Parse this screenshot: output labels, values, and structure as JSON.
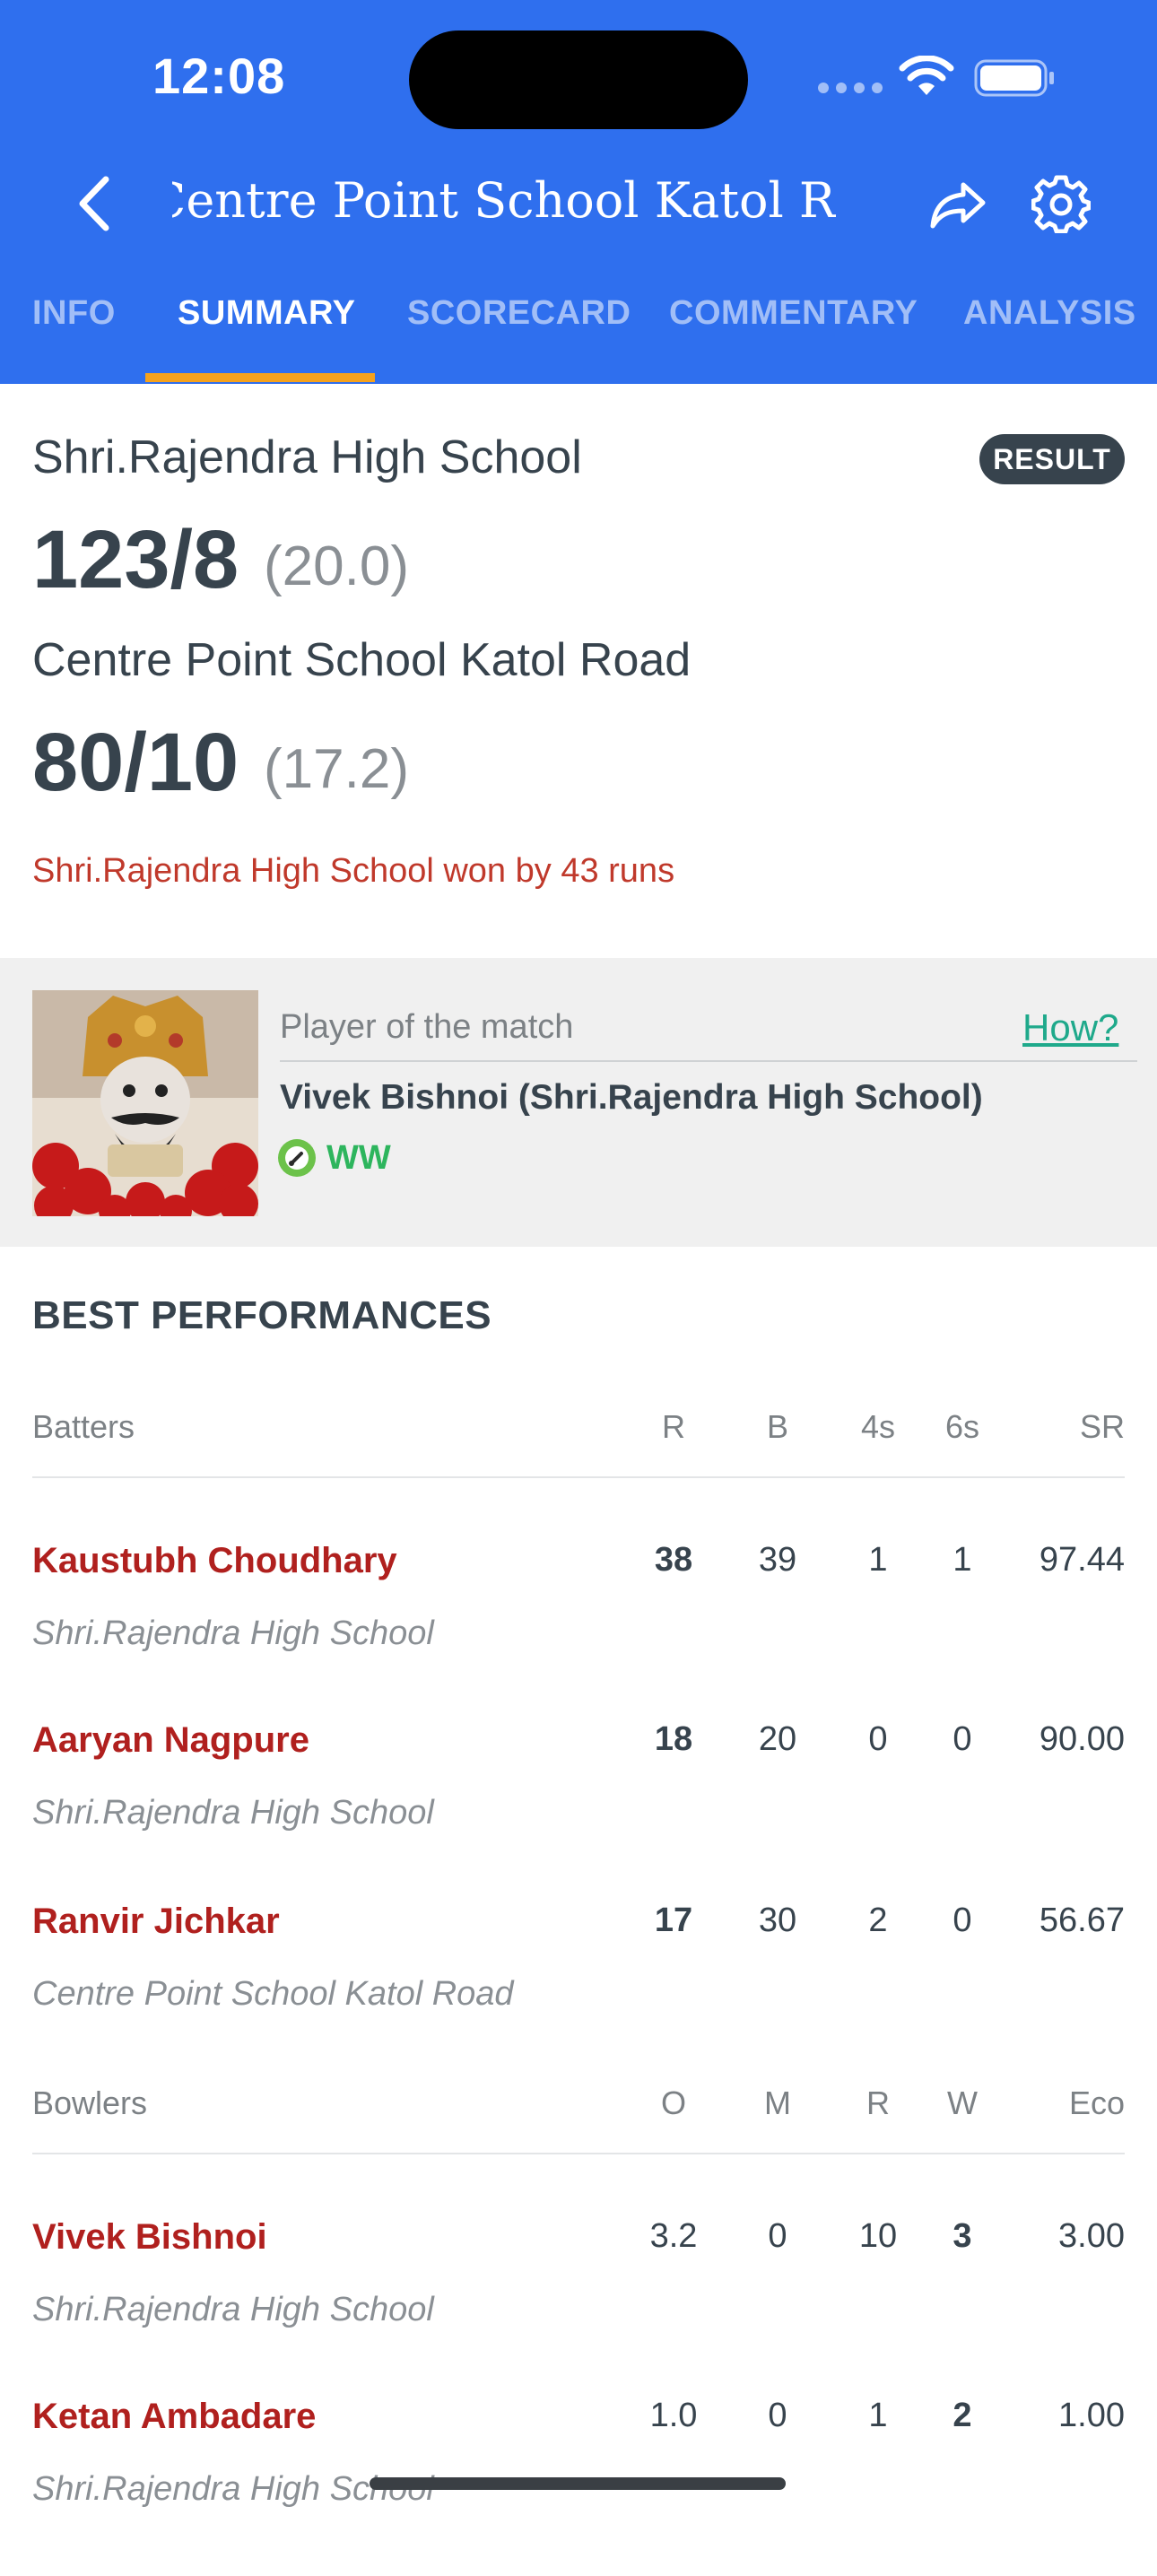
{
  "status_bar": {
    "time": "12:08"
  },
  "header": {
    "title": "Centre Point School Katol Road vs Shri.Rajendra High School",
    "tabs": [
      "INFO",
      "SUMMARY",
      "SCORECARD",
      "COMMENTARY",
      "ANALYSIS"
    ],
    "active_tab": "SUMMARY",
    "colors": {
      "bar": "#2f6fee",
      "indicator": "#f6a21d"
    }
  },
  "summary": {
    "team1": {
      "name": "Shri.Rajendra High School",
      "score": "123/8",
      "overs": "(20.0)"
    },
    "team2": {
      "name": "Centre Point School Katol Road",
      "score": "80/10",
      "overs": "(17.2)"
    },
    "badge": "RESULT",
    "result": "Shri.Rajendra High School won by 43 runs"
  },
  "player_of_match": {
    "label": "Player of the match",
    "how_link": "How?",
    "name": "Vivek Bishnoi (Shri.Rajendra High School)",
    "tag": "WW"
  },
  "best_performances": {
    "title": "BEST PERFORMANCES",
    "batters_header": [
      "Batters",
      "R",
      "B",
      "4s",
      "6s",
      "SR"
    ],
    "batters": [
      {
        "name": "Kaustubh Choudhary",
        "team": "Shri.Rajendra High School",
        "r": "38",
        "b": "39",
        "fours": "1",
        "sixes": "1",
        "sr": "97.44"
      },
      {
        "name": "Aaryan Nagpure",
        "team": "Shri.Rajendra High School",
        "r": "18",
        "b": "20",
        "fours": "0",
        "sixes": "0",
        "sr": "90.00"
      },
      {
        "name": "Ranvir Jichkar",
        "team": "Centre Point School Katol Road",
        "r": "17",
        "b": "30",
        "fours": "2",
        "sixes": "0",
        "sr": "56.67"
      }
    ],
    "bowlers_header": [
      "Bowlers",
      "O",
      "M",
      "R",
      "W",
      "Eco"
    ],
    "bowlers": [
      {
        "name": "Vivek Bishnoi",
        "team": "Shri.Rajendra High School",
        "o": "3.2",
        "m": "0",
        "r": "10",
        "w": "3",
        "eco": "3.00"
      },
      {
        "name": "Ketan Ambadare",
        "team": "Shri.Rajendra High School",
        "o": "1.0",
        "m": "0",
        "r": "1",
        "w": "2",
        "eco": "1.00"
      }
    ]
  }
}
